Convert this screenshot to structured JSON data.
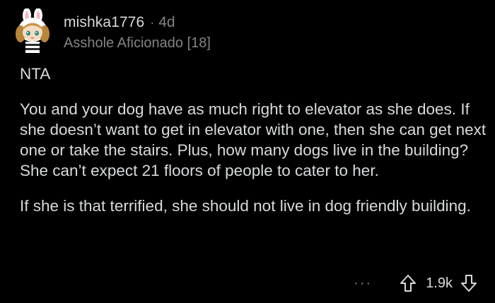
{
  "comment": {
    "username": "mishka1776",
    "separator": "·",
    "age": "4d",
    "flair": "Asshole Aficionado [18]",
    "paragraphs": [
      "NTA",
      "You and your dog have as much right to elevator as she does. If she doesn’t want to get in elevator with one, then she can get next one or take the stairs. Plus, how many dogs live in the building? She can’t expect 21 floors of people to cater to her.",
      "If she is that terrified, she should not live in dog friendly building."
    ],
    "actions": {
      "more_label": "···",
      "score": "1.9k",
      "upvote_icon": "upvote-arrow-icon",
      "downvote_icon": "downvote-arrow-icon"
    }
  },
  "colors": {
    "background": "#000000",
    "text_primary": "#d7dadc",
    "text_secondary": "#818384"
  }
}
